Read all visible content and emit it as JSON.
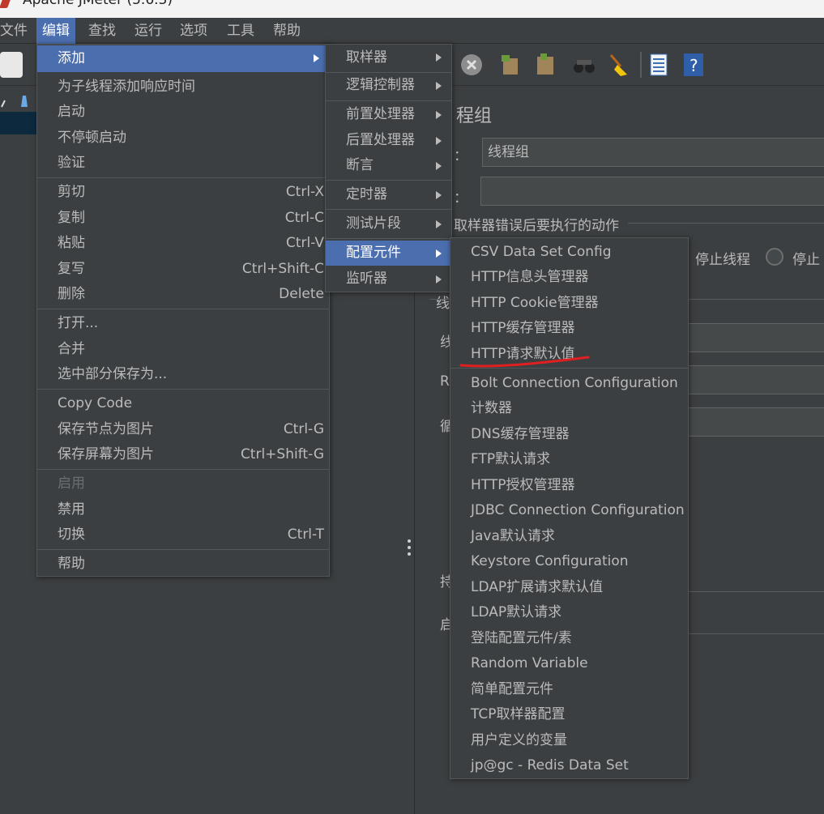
{
  "window": {
    "title": "Apache JMeter (5.6.3)"
  },
  "menubar": {
    "items": [
      "文件",
      "编辑",
      "查找",
      "运行",
      "选项",
      "工具",
      "帮助"
    ]
  },
  "edit_menu": {
    "add": "添加",
    "group1": [
      "为子线程添加响应时间",
      "启动",
      "不停顿启动",
      "验证"
    ],
    "cut": {
      "label": "剪切",
      "shortcut": "Ctrl-X"
    },
    "copy": {
      "label": "复制",
      "shortcut": "Ctrl-C"
    },
    "paste": {
      "label": "粘贴",
      "shortcut": "Ctrl-V"
    },
    "duplicate": {
      "label": "复写",
      "shortcut": "Ctrl+Shift-C"
    },
    "delete": {
      "label": "删除",
      "shortcut": "Delete"
    },
    "open": "打开...",
    "merge": "合并",
    "save_selection": "选中部分保存为...",
    "copy_code": "Copy Code",
    "save_node_image": {
      "label": "保存节点为图片",
      "shortcut": "Ctrl-G"
    },
    "save_screen_image": {
      "label": "保存屏幕为图片",
      "shortcut": "Ctrl+Shift-G"
    },
    "enable": "启用",
    "disable": "禁用",
    "toggle": {
      "label": "切换",
      "shortcut": "Ctrl-T"
    },
    "help": "帮助"
  },
  "add_submenu": {
    "items": [
      "取样器",
      "逻辑控制器",
      "前置处理器",
      "后置处理器",
      "断言",
      "定时器",
      "测试片段",
      "配置元件",
      "监听器"
    ]
  },
  "config_submenu": {
    "items": [
      "CSV Data Set Config",
      "HTTP信息头管理器",
      "HTTP Cookie管理器",
      "HTTP缓存管理器",
      "HTTP请求默认值",
      "Bolt Connection Configuration",
      "计数器",
      "DNS缓存管理器",
      "FTP默认请求",
      "HTTP授权管理器",
      "JDBC Connection Configuration",
      "Java默认请求",
      "Keystore Configuration",
      "LDAP扩展请求默认值",
      "LDAP默认请求",
      "登陆配置元件/素",
      "Random Variable",
      "简单配置元件",
      "TCP取样器配置",
      "用户定义的变量",
      "jp@gc - Redis Data Set"
    ]
  },
  "thread_group_panel": {
    "title": "程组",
    "name_label": "：",
    "name_value": "线程组",
    "comment_label": "：",
    "error_action_label": "取样器错误后要执行的动作",
    "stop_thread": "停止线程",
    "stop_test": "停止",
    "thread_props": "线",
    "row_labels": [
      "线",
      "R",
      "循",
      "持",
      "启"
    ]
  },
  "colors": {
    "menu_bg": "#3c3f41",
    "highlight": "#4b6eaf",
    "annotation": "#e02020"
  }
}
